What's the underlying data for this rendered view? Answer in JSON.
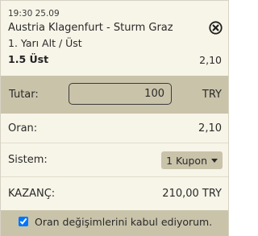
{
  "bet": {
    "datetime": "19:30 25.09",
    "match": "Austria Klagenfurt - Sturm Graz",
    "market": "1. Yarı Alt / Üst",
    "selection": "1.5 Üst",
    "odds": "2,10",
    "close_icon": "close-circle-icon"
  },
  "stake": {
    "label": "Tutar:",
    "value": "100",
    "currency": "TRY"
  },
  "summary": {
    "odds_label": "Oran:",
    "odds_value": "2,10",
    "system_label": "Sistem:",
    "system_value": "1 Kupon",
    "system_icon": "caret-down-icon",
    "win_label": "KAZANÇ:",
    "win_value": "210,00 TRY"
  },
  "footer": {
    "accept_label": "Oran değişimlerini kabul ediyorum.",
    "accept_checked": true
  }
}
